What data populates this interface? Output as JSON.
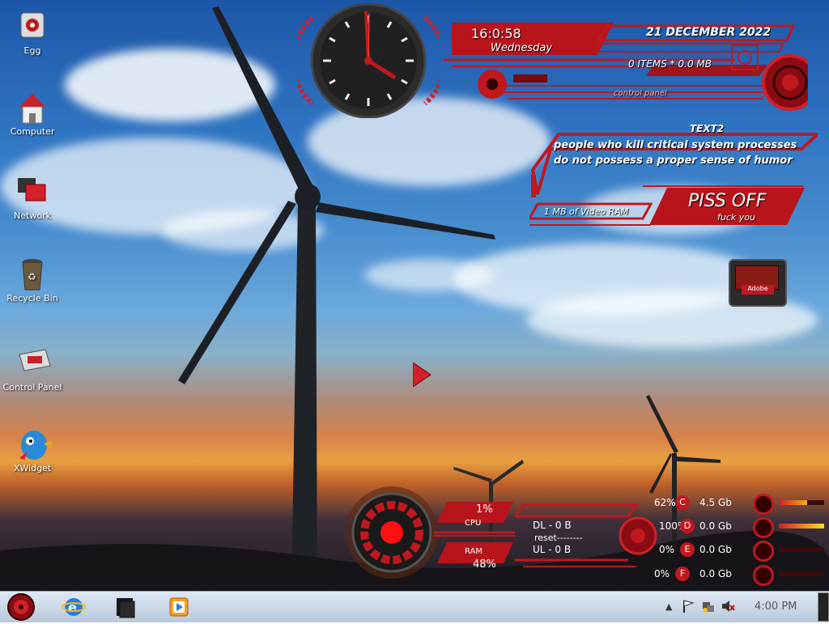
{
  "desktop": {
    "icons": [
      {
        "label": "Egg",
        "icon": "egg-icon"
      },
      {
        "label": "Computer",
        "icon": "computer-icon"
      },
      {
        "label": "Network",
        "icon": "network-icon"
      },
      {
        "label": "Recycle Bin",
        "icon": "recycle-bin-icon"
      },
      {
        "label": "Control Panel",
        "icon": "control-panel-icon"
      },
      {
        "label": "XWidget",
        "icon": "xwidget-icon"
      }
    ]
  },
  "widgets": {
    "clock": {
      "time": "16:0:58",
      "day": "Wednesday",
      "date": "21 DECEMBER 2022"
    },
    "recycle": {
      "items": "0 ITEMS * 0.0 MB",
      "control_panel": "control panel"
    },
    "text": {
      "title": "TEXT2",
      "line1": "people who kill critical system processes",
      "line2": "do not possess a proper sense of humor"
    },
    "video": {
      "ram": "1 MB of Video RAM",
      "big": "PISS OFF",
      "small": "fuck you"
    },
    "adobe": {
      "label": "Adobe"
    },
    "cpu": {
      "cpu_value": "1%",
      "cpu_label": "CPU",
      "ram_label": "RAM",
      "ram_value": "48%"
    },
    "network": {
      "dl": "DL - 0 B",
      "reset": "reset--------",
      "ul": "UL - 0 B"
    },
    "drives": [
      {
        "percent": "62%",
        "letter": "C",
        "size": "4.5 Gb",
        "fill": 0.62
      },
      {
        "percent": "100%",
        "letter": "D",
        "size": "0.0 Gb",
        "fill": 1.0
      },
      {
        "percent": "0%",
        "letter": "E",
        "size": "0.0 Gb",
        "fill": 0.0
      },
      {
        "percent": "0%",
        "letter": "F",
        "size": "0.0 Gb",
        "fill": 0.0
      }
    ]
  },
  "taskbar": {
    "clock": "4:00 PM",
    "items": [
      "start-orb-icon",
      "internet-explorer-icon",
      "file-explorer-icon",
      "media-player-icon"
    ]
  },
  "colors": {
    "accent": "#e0202a",
    "dark": "#1a1a1a"
  }
}
